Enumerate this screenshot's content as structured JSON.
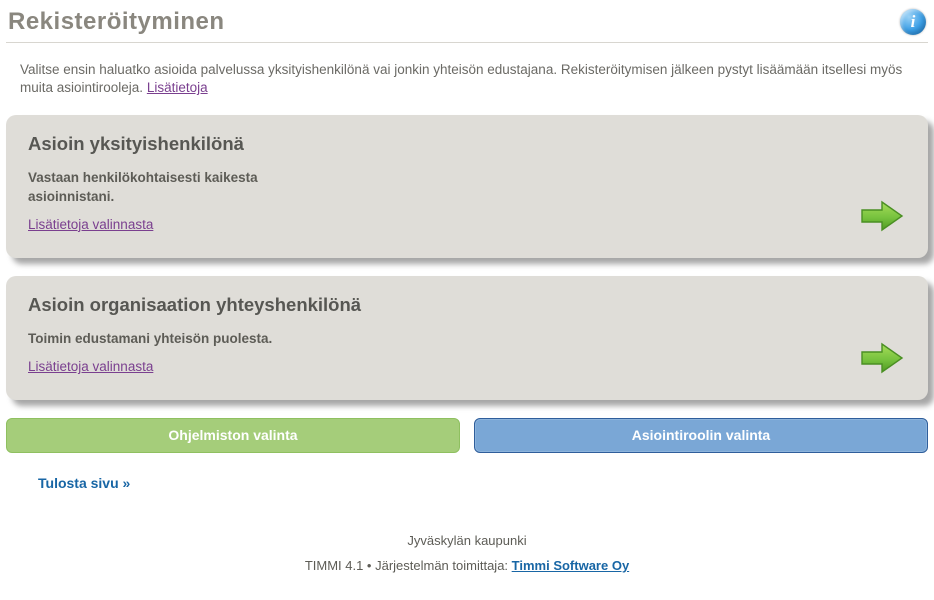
{
  "header": {
    "title": "Rekisteröityminen"
  },
  "intro": {
    "text": "Valitse ensin haluatko asioida palvelussa yksityishenkilönä vai jonkin yhteisön edustajana. Rekisteröitymisen jälkeen pystyt lisäämään itsellesi myös muita asiointirooleja. ",
    "more_link": "Lisätietoja"
  },
  "cards": [
    {
      "title": "Asioin yksityishenkilönä",
      "sub": "Vastaan henkilökohtaisesti kaikesta asioinnistani.",
      "link": "Lisätietoja valinnasta"
    },
    {
      "title": "Asioin organisaation yhteyshenkilönä",
      "sub": "Toimin edustamani yhteisön puolesta.",
      "link": "Lisätietoja valinnasta"
    }
  ],
  "buttons": {
    "left": "Ohjelmiston valinta",
    "right": "Asiointiroolin valinta"
  },
  "print_link": "Tulosta sivu »",
  "footer": {
    "line1": "Jyväskylän kaupunki",
    "line2_prefix": "TIMMI 4.1 • Järjestelmän toimittaja: ",
    "vendor_link": "Timmi Software Oy"
  }
}
